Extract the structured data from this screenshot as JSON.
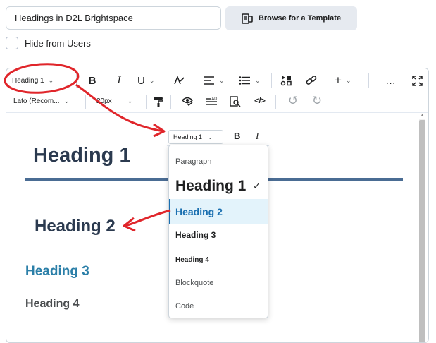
{
  "title_field": {
    "value": "Headings in D2L Brightspace"
  },
  "browse_button": {
    "label": "Browse for a Template"
  },
  "hide_from_users": {
    "label": "Hide from Users",
    "checked": false
  },
  "toolbar": {
    "block_format": {
      "value": "Heading 1"
    },
    "font_family": {
      "value": "Lato (Recom..."
    },
    "font_size": {
      "value": "20px"
    },
    "bold": "B",
    "italic": "I",
    "underline": "U",
    "more": "…"
  },
  "content": {
    "heading1": "Heading 1",
    "heading2": "Heading 2",
    "heading3": "Heading 3",
    "heading4": "Heading 4"
  },
  "format_menu": {
    "toolbar": {
      "block_format": "Heading 1",
      "bold": "B",
      "italic": "I"
    },
    "items": [
      {
        "label": "Paragraph",
        "selected": false
      },
      {
        "label": "Heading 1",
        "selected": true
      },
      {
        "label": "Heading 2",
        "highlighted": true
      },
      {
        "label": "Heading 3"
      },
      {
        "label": "Heading 4"
      },
      {
        "label": "Blockquote"
      },
      {
        "label": "Code"
      }
    ]
  },
  "colors": {
    "accent_blue": "#1a6fb0",
    "heading3_teal": "#2b7fa8",
    "heading1_rule": "#4a6c93",
    "annotation_red": "#e0262b"
  }
}
